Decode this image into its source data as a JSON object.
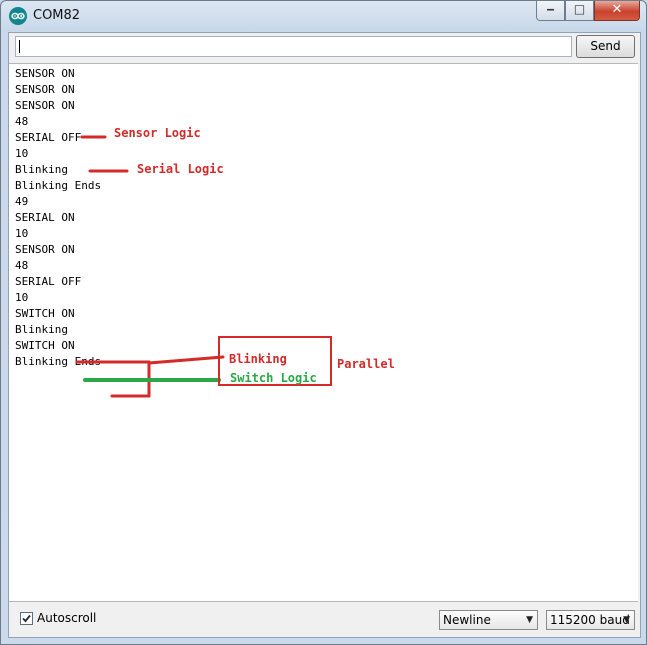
{
  "window": {
    "title": "COM82"
  },
  "input": {
    "value": ""
  },
  "send_label": "Send",
  "serial_lines": [
    "SENSOR ON",
    "SENSOR ON",
    "SENSOR ON",
    "48",
    "SERIAL OFF",
    "10",
    "Blinking",
    "Blinking Ends",
    "49",
    "SERIAL ON",
    "10",
    "SENSOR ON",
    "48",
    "SERIAL OFF",
    "10",
    "SWITCH ON",
    "Blinking",
    "SWITCH ON",
    "Blinking Ends"
  ],
  "annotations": {
    "sensor_logic": "Sensor Logic",
    "serial_logic": "Serial Logic",
    "blinking": "Blinking",
    "switch_logic": "Switch Logic",
    "parallel": "Parallel"
  },
  "footer": {
    "autoscroll_label": "Autoscroll",
    "autoscroll_checked": true,
    "line_ending": "Newline",
    "baud": "115200 baud"
  },
  "colors": {
    "annotation_red": "#d42a2a",
    "annotation_green": "#2aa845",
    "close_button": "#c7432e"
  }
}
